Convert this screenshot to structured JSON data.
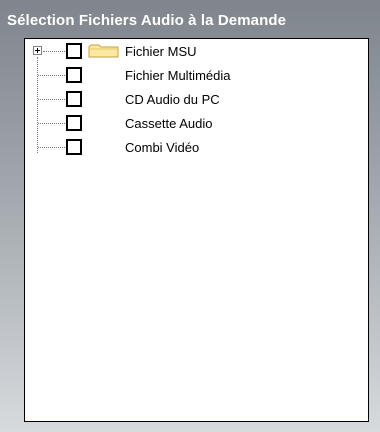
{
  "panel": {
    "title": "Sélection Fichiers Audio à la Demande"
  },
  "tree": {
    "items": [
      {
        "label": "Fichier MSU",
        "expandable": true,
        "checked": false,
        "icon": "folder-icon"
      },
      {
        "label": "Fichier Multimédia",
        "expandable": false,
        "checked": false
      },
      {
        "label": "CD Audio du PC",
        "expandable": false,
        "checked": false
      },
      {
        "label": "Cassette Audio",
        "expandable": false,
        "checked": false
      },
      {
        "label": "Combi Vidéo",
        "expandable": false,
        "checked": false
      }
    ]
  },
  "colors": {
    "title_text": "#ffffff",
    "panel_gradient_top": "#7f858c",
    "panel_gradient_bottom": "#d7dbde",
    "folder_fill": "#fbe8a3",
    "folder_stroke": "#c9a23a"
  }
}
